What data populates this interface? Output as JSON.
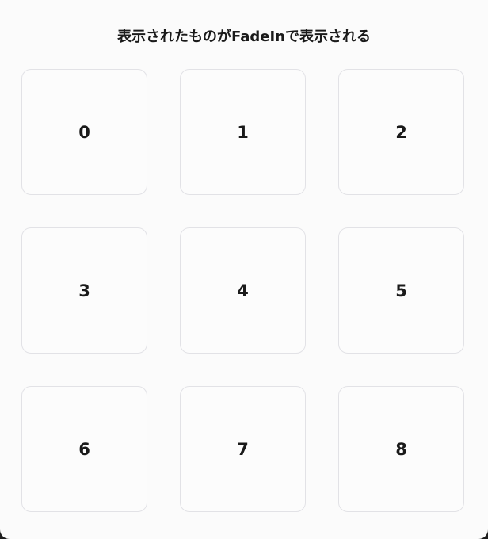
{
  "page": {
    "title": "表示されたものがFadeInで表示される"
  },
  "cards": [
    {
      "label": "0"
    },
    {
      "label": "1"
    },
    {
      "label": "2"
    },
    {
      "label": "3"
    },
    {
      "label": "4"
    },
    {
      "label": "5"
    },
    {
      "label": "6"
    },
    {
      "label": "7"
    },
    {
      "label": "8"
    }
  ],
  "colors": {
    "background": "#fbfbfb",
    "card_border": "#e2e2e6",
    "text": "#1a1a1a"
  }
}
